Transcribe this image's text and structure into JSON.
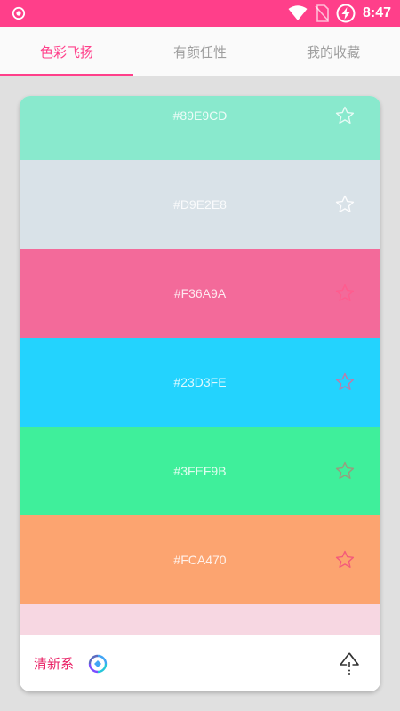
{
  "status_bar": {
    "time": "8:47",
    "left_icon": "target-icon",
    "right_icons": [
      "wifi-icon",
      "no-sim-icon",
      "battery-charging-icon"
    ],
    "color": "#ff3f8a"
  },
  "tabs": [
    {
      "label": "色彩飞扬",
      "active": true
    },
    {
      "label": "有颜任性",
      "active": false
    },
    {
      "label": "我的收藏",
      "active": false
    }
  ],
  "palette": {
    "colors": [
      {
        "hex": "#89E9CD",
        "fill": "#89E9CD"
      },
      {
        "hex": "#D9E2E8",
        "fill": "#D9E2E8"
      },
      {
        "hex": "#F36A9A",
        "fill": "#F36A9A"
      },
      {
        "hex": "#23D3FE",
        "fill": "#23D3FE"
      },
      {
        "hex": "#3FEF9B",
        "fill": "#3FEF9B"
      },
      {
        "hex": "#FCA470",
        "fill": "#FCA470"
      },
      {
        "hex": "",
        "fill": "#F7D7E2"
      }
    ],
    "star_icon": "star-outline-icon"
  },
  "bottom_bar": {
    "title": "清新系",
    "refresh_icon": "refresh-icon",
    "share_icon": "share-icon"
  },
  "accent_color": "#ff3f8a"
}
